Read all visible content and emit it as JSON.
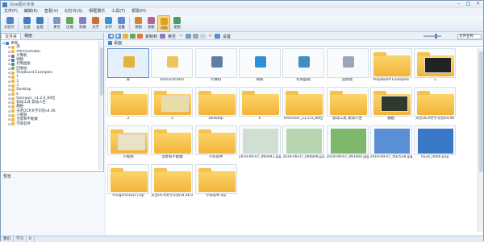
{
  "window": {
    "title": "iSee图片专家"
  },
  "menu": [
    "文件(F)",
    "编辑(E)",
    "查看(V)",
    "幻灯片(S)",
    "相框娱乐",
    "工具(T)",
    "帮助(H)"
  ],
  "toolbar": [
    {
      "label": "幻灯片",
      "icon": "slideshow-icon",
      "color": "#4f86c6"
    },
    {
      "label": "左旋",
      "icon": "rotate-left-icon",
      "color": "#3f7fbf"
    },
    {
      "label": "右旋",
      "icon": "rotate-right-icon",
      "color": "#3f7fbf"
    },
    {
      "label": "更名",
      "icon": "rename-icon",
      "color": "#7a9bc2"
    },
    {
      "label": "压缩",
      "icon": "compress-icon",
      "color": "#6aa84f"
    },
    {
      "label": "转换",
      "icon": "convert-icon",
      "color": "#8e7cc3"
    },
    {
      "label": "文字",
      "icon": "text-icon",
      "color": "#cc6d3a"
    },
    {
      "label": "水印",
      "icon": "watermark-icon",
      "color": "#2f9bd6"
    },
    {
      "label": "批量",
      "icon": "batch-icon",
      "color": "#5b8ccf"
    },
    {
      "label": "拼图",
      "icon": "collage-icon",
      "color": "#d9822b"
    },
    {
      "label": "相框",
      "icon": "frame-icon",
      "color": "#b65f9a"
    },
    {
      "label": "动画",
      "icon": "animation-icon",
      "color": "#e0a21a",
      "active": true
    },
    {
      "label": "抠图",
      "icon": "cutout-icon",
      "color": "#4a9a6a"
    }
  ],
  "left": {
    "tabs": [
      "文件夹",
      "相册"
    ],
    "tree": [
      {
        "label": "桌面",
        "depth": 0,
        "color": "#3b82c4"
      },
      {
        "label": "库",
        "depth": 1,
        "color": "#f2b43a"
      },
      {
        "label": "Administrator",
        "depth": 1,
        "color": "#f2b43a"
      },
      {
        "label": "计算机",
        "depth": 1,
        "color": "#6b7c93"
      },
      {
        "label": "网络",
        "depth": 1,
        "color": "#3b82c4"
      },
      {
        "label": "控制面板",
        "depth": 1,
        "color": "#4a9a6a"
      },
      {
        "label": "回收站",
        "depth": 1,
        "color": "#8a97a8"
      },
      {
        "label": "PolyBoard Examples",
        "depth": 1,
        "color": "#f2b43a"
      },
      {
        "label": "1",
        "depth": 1,
        "color": "#f2b43a"
      },
      {
        "label": "2",
        "depth": 1,
        "color": "#f2b43a"
      },
      {
        "label": "3",
        "depth": 1,
        "color": "#f2b43a"
      },
      {
        "label": "Desktop",
        "depth": 1,
        "color": "#f2b43a"
      },
      {
        "label": "k",
        "depth": 1,
        "color": "#f2b43a"
      },
      {
        "label": "tianruocr_v1.2.0_84位",
        "depth": 1,
        "color": "#f2b43a"
      },
      {
        "label": "驱动工具 驱动人生",
        "depth": 1,
        "color": "#f2b43a"
      },
      {
        "label": "翻拍",
        "depth": 1,
        "color": "#f2b43a"
      },
      {
        "label": "天若OCR文字识别v4.46",
        "depth": 1,
        "color": "#f2b43a"
      },
      {
        "label": "小视频",
        "depth": 1,
        "color": "#f2b43a"
      },
      {
        "label": "注意和不能做",
        "depth": 1,
        "color": "#f2b43a"
      },
      {
        "label": "学库软件",
        "depth": 1,
        "color": "#f2b43a"
      }
    ],
    "preview_label": "预览"
  },
  "nav": {
    "copy_label": "复制到",
    "move_label": "移至",
    "settings_label": "设置",
    "sort_label": "文件名称",
    "address": "桌面"
  },
  "items": [
    {
      "caption": "库",
      "kind": "sys",
      "color": "#e5b33c",
      "selected": true
    },
    {
      "caption": "Administrator",
      "kind": "sys",
      "color": "#f0c45a"
    },
    {
      "caption": "计算机",
      "kind": "sys",
      "color": "#5f7ea6"
    },
    {
      "caption": "网络",
      "kind": "sys",
      "color": "#2f8fd6"
    },
    {
      "caption": "控制面板",
      "kind": "sys",
      "color": "#3f8fbf"
    },
    {
      "caption": "回收站",
      "kind": "sys",
      "color": "#9aa7b6"
    },
    {
      "caption": "PolyBoard Examples",
      "kind": "folder"
    },
    {
      "caption": "1",
      "kind": "folder-img",
      "color": "#222"
    },
    {
      "caption": "2",
      "kind": "folder"
    },
    {
      "caption": "3",
      "kind": "folder-img",
      "color": "#e8dca8"
    },
    {
      "caption": "Desktop",
      "kind": "folder"
    },
    {
      "caption": "k",
      "kind": "folder"
    },
    {
      "caption": "tianruocr_v1.2.0_84位",
      "kind": "folder"
    },
    {
      "caption": "驱动工具 驱动人生",
      "kind": "folder"
    },
    {
      "caption": "翻拍",
      "kind": "folder-img",
      "color": "#2d3a2d"
    },
    {
      "caption": "天若OCR文字识别v4.46",
      "kind": "folder"
    },
    {
      "caption": "小视频",
      "kind": "folder-img",
      "color": "#e9e2c4"
    },
    {
      "caption": "注意和不能做",
      "kind": "folder"
    },
    {
      "caption": "学库软件",
      "kind": "folder"
    },
    {
      "caption": "2019-09-07_095941.jpg",
      "kind": "image",
      "color": "#cfe0d2"
    },
    {
      "caption": "2019-09-07_090848.jpg",
      "kind": "image",
      "color": "#b9d4b0"
    },
    {
      "caption": "2019-09-07_091000.jpg",
      "kind": "image",
      "color": "#7fb86a"
    },
    {
      "caption": "2019-09-07_092528.jpg",
      "kind": "image",
      "color": "#5a8fd6"
    },
    {
      "caption": "hyv4_0000.png",
      "kind": "image",
      "color": "#3a78c8"
    },
    {
      "caption": "minganciku(1).zip",
      "kind": "folder"
    },
    {
      "caption": "天若OCR文字识别v4.46.zip",
      "kind": "folder"
    },
    {
      "caption": "学库软件.zip",
      "kind": "folder"
    }
  ],
  "status": {
    "count_label": "1",
    "cells": [
      "我们",
      "学习",
      "0"
    ]
  }
}
